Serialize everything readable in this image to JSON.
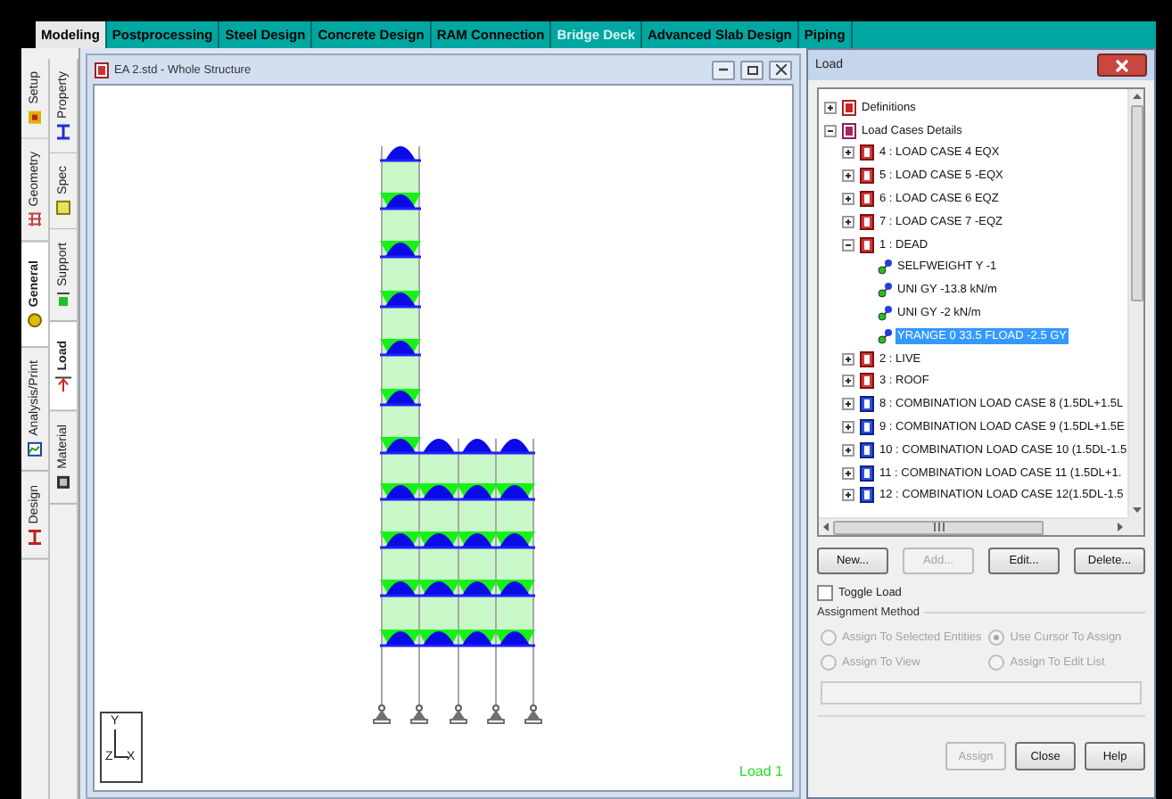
{
  "tabs": [
    {
      "label": "Modeling",
      "selected": true,
      "disabled": false
    },
    {
      "label": "Postprocessing",
      "selected": false,
      "disabled": false
    },
    {
      "label": "Steel Design",
      "selected": false,
      "disabled": false
    },
    {
      "label": "Concrete Design",
      "selected": false,
      "disabled": false
    },
    {
      "label": "RAM Connection",
      "selected": false,
      "disabled": false
    },
    {
      "label": "Bridge Deck",
      "selected": false,
      "disabled": true
    },
    {
      "label": "Advanced Slab Design",
      "selected": false,
      "disabled": false
    },
    {
      "label": "Piping",
      "selected": false,
      "disabled": false
    }
  ],
  "side_tabs": {
    "outer": [
      {
        "label": "Setup",
        "selected": false
      },
      {
        "label": "Geometry",
        "selected": false
      },
      {
        "label": "General",
        "selected": true
      },
      {
        "label": "Analysis/Print",
        "selected": false
      },
      {
        "label": "Design",
        "selected": false
      }
    ],
    "inner": [
      {
        "label": "Property",
        "selected": false
      },
      {
        "label": "Spec",
        "selected": false
      },
      {
        "label": "Support",
        "selected": false
      },
      {
        "label": "Load",
        "selected": true
      },
      {
        "label": "Material",
        "selected": false
      }
    ]
  },
  "structure_window": {
    "title": "EA 2.std - Whole Structure",
    "axis": {
      "y": "Y",
      "z": "Z",
      "x": "X"
    },
    "load_label": "Load 1"
  },
  "load_dialog": {
    "title": "Load",
    "tree": [
      {
        "label": "Definitions",
        "kind": "definitions",
        "expanded": false,
        "selected": false
      },
      {
        "label": "Load Cases Details",
        "kind": "details",
        "expanded": true,
        "selected": false,
        "children": [
          {
            "label": "4 : LOAD CASE 4 EQX",
            "kind": "case",
            "expanded": false,
            "selected": false
          },
          {
            "label": "5 : LOAD CASE 5 -EQX",
            "kind": "case",
            "expanded": false,
            "selected": false
          },
          {
            "label": "6 : LOAD CASE 6 EQZ",
            "kind": "case",
            "expanded": false,
            "selected": false
          },
          {
            "label": "7 : LOAD CASE 7 -EQZ",
            "kind": "case",
            "expanded": false,
            "selected": false
          },
          {
            "label": "1 : DEAD",
            "kind": "case",
            "expanded": true,
            "selected": false,
            "children": [
              {
                "label": "SELFWEIGHT Y -1",
                "kind": "load",
                "selected": false
              },
              {
                "label": "UNI GY -13.8 kN/m",
                "kind": "load",
                "selected": false
              },
              {
                "label": "UNI GY -2 kN/m",
                "kind": "load",
                "selected": false
              },
              {
                "label": "YRANGE 0 33.5 FLOAD -2.5 GY",
                "kind": "load",
                "selected": true
              }
            ]
          },
          {
            "label": "2 : LIVE",
            "kind": "case",
            "expanded": false,
            "selected": false
          },
          {
            "label": "3 : ROOF",
            "kind": "case",
            "expanded": false,
            "selected": false
          },
          {
            "label": "8 : COMBINATION LOAD CASE 8 (1.5DL+1.5L",
            "kind": "combination",
            "expanded": false,
            "selected": false
          },
          {
            "label": "9 : COMBINATION LOAD CASE 9 (1.5DL+1.5E",
            "kind": "combination",
            "expanded": false,
            "selected": false
          },
          {
            "label": "10 : COMBINATION LOAD CASE 10 (1.5DL-1.5",
            "kind": "combination",
            "expanded": false,
            "selected": false
          },
          {
            "label": "11 : COMBINATION LOAD CASE 11 (1.5DL+1.",
            "kind": "combination",
            "expanded": false,
            "selected": false
          },
          {
            "label": "12 : COMBINATION LOAD CASE 12(1.5DL-1.5",
            "kind": "combination",
            "expanded": false,
            "selected": false
          }
        ]
      }
    ],
    "buttons": [
      {
        "label": "New...",
        "disabled": false
      },
      {
        "label": "Add...",
        "disabled": true
      },
      {
        "label": "Edit...",
        "disabled": false
      },
      {
        "label": "Delete...",
        "disabled": false
      }
    ],
    "toggle_load": {
      "label": "Toggle Load",
      "checked": false
    },
    "assignment_method": {
      "title": "Assignment Method",
      "options": [
        {
          "label": "Assign To Selected Entities",
          "selected": false,
          "disabled": true
        },
        {
          "label": "Use Cursor To Assign",
          "selected": true,
          "disabled": true
        },
        {
          "label": "Assign To View",
          "selected": false,
          "disabled": true
        },
        {
          "label": "Assign To Edit List",
          "selected": false,
          "disabled": true
        }
      ]
    },
    "bottom_buttons": [
      {
        "label": "Assign",
        "disabled": true
      },
      {
        "label": "Close",
        "disabled": false
      },
      {
        "label": "Help",
        "disabled": false
      }
    ]
  }
}
